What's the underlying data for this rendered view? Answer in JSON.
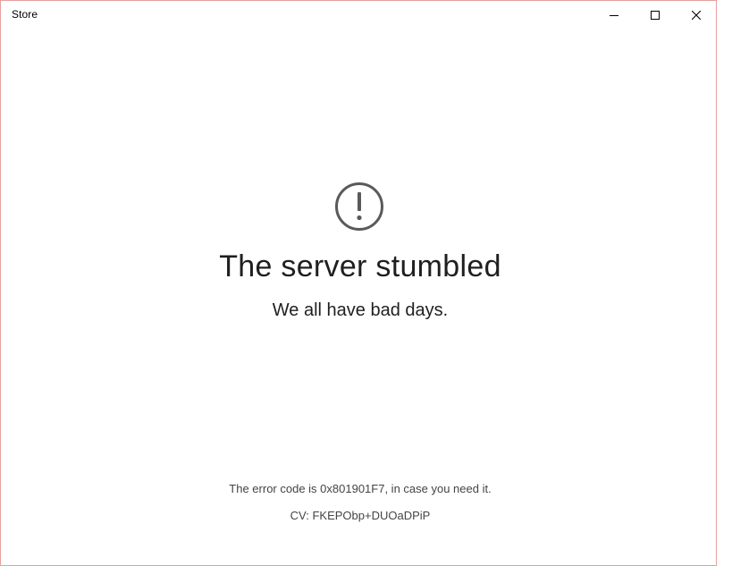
{
  "window": {
    "title": "Store",
    "border_color": "#e8a0a0"
  },
  "caption_buttons": {
    "minimize_icon": "minimize-icon",
    "maximize_icon": "maximize-icon",
    "close_icon": "close-icon"
  },
  "error": {
    "icon": "exclamation-circle-icon",
    "headline": "The server stumbled",
    "subhead": "We all have bad days.",
    "code_text": "The error code is 0x801901F7, in case you need it.",
    "cv_text": "CV: FKEPObp+DUOaDPiP"
  }
}
